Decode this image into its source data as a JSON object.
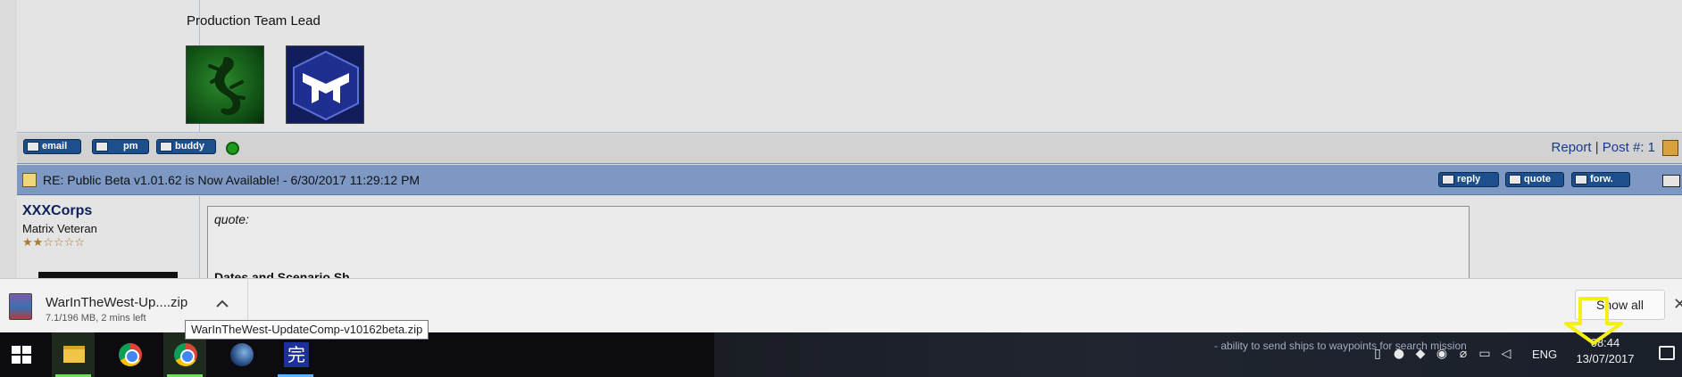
{
  "signature": {
    "title": "Production Team Lead",
    "image1": "lizard-logo",
    "image2": "matrix-logo"
  },
  "post_actions": {
    "email_label": "email",
    "pm_label": "pm",
    "buddy_label": "buddy",
    "report_label": "Report",
    "separator": "|",
    "post_number": "Post #: 1"
  },
  "post_header": {
    "title": "RE: Public Beta v1.01.62 is Now Available! - 6/30/2017 11:29:12 PM",
    "reply_label": "reply",
    "quote_label": "quote",
    "forward_label": "forw."
  },
  "author": {
    "username": "XXXCorps",
    "rank": "Matrix Veteran",
    "stars": "★★☆☆☆☆"
  },
  "quote": {
    "label": "quote:",
    "bold_text": "Dates and Scenario Sh..."
  },
  "download": {
    "filename_short": "WarInTheWest-Up....zip",
    "status": "7.1/196 MB, 2 mins left",
    "tooltip": "WarInTheWest-UpdateComp-v10162beta.zip",
    "show_all": "Show all",
    "close": "✕"
  },
  "taskbar": {
    "background_text": "- ability to send ships to waypoints for search mission",
    "language": "ENG",
    "time": "08:44",
    "date": "13/07/2017"
  },
  "colors": {
    "header_blue": "#7e98c4",
    "button_blue": "#1d4f8c",
    "highlight_yellow": "#f4ef17",
    "online_green": "#1f9a1f"
  }
}
